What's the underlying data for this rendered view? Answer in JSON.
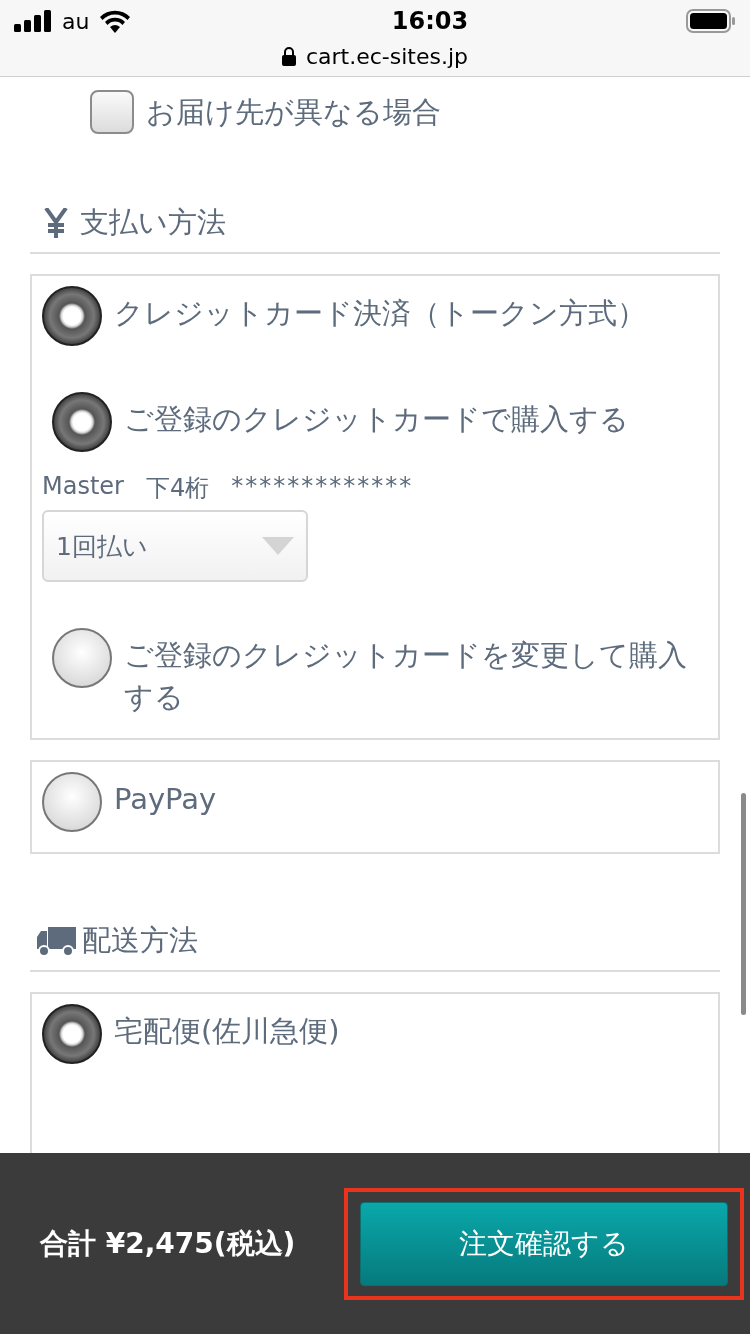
{
  "status_bar": {
    "carrier": "au",
    "time": "16:03",
    "url": "cart.ec-sites.jp"
  },
  "different_address": {
    "label": "お届け先が異なる場合",
    "checked": false
  },
  "payment": {
    "title": "支払い方法",
    "methods": [
      {
        "label": "クレジットカード決済（トークン方式）",
        "selected": true,
        "options": [
          {
            "label": "ご登録のクレジットカードで購入する",
            "selected": true,
            "card_brand": "Master",
            "last4_label": "下4桁",
            "card_number": "*************",
            "installments": "1回払い"
          },
          {
            "label": "ご登録のクレジットカードを変更して購入する",
            "selected": false
          }
        ]
      },
      {
        "label": "PayPay",
        "selected": false
      }
    ]
  },
  "delivery": {
    "title": "配送方法",
    "methods": [
      {
        "label": "宅配便(佐川急便)",
        "selected": true
      }
    ]
  },
  "footer": {
    "total": "合計 ¥2,475(税込)",
    "button": "注文確認する",
    "highlighted": true
  }
}
